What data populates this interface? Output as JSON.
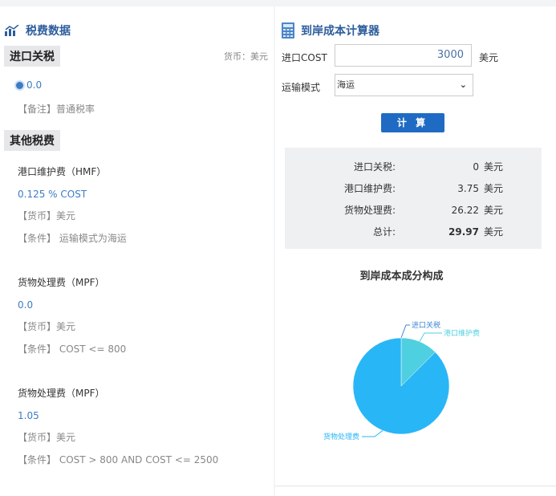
{
  "left": {
    "title": "税费数据",
    "title_icon": "bar-chart-icon",
    "import_tax": {
      "heading": "进口关税",
      "currency_note": "货币：美元",
      "rate": "0.0",
      "note": "【备注】普通税率"
    },
    "other": {
      "heading": "其他税费",
      "items": [
        {
          "name": "港口维护费（HMF）",
          "value": "0.125 % COST",
          "currency": "【货币】美元",
          "condition": "【条件】 运输模式为海运"
        },
        {
          "name": "货物处理费（MPF）",
          "value": "0.0",
          "currency": "【货币】美元",
          "condition": "【条件】 COST <= 800"
        },
        {
          "name": "货物处理费（MPF）",
          "value": "1.05",
          "currency": "【货币】美元",
          "condition": "【条件】 COST > 800 AND COST <= 2500"
        }
      ]
    }
  },
  "right": {
    "title": "到岸成本计算器",
    "title_icon": "calculator-icon",
    "cost_label": "进口COST",
    "cost_value": "3000",
    "cost_unit": "美元",
    "mode_label": "运输模式",
    "mode_value": "海运",
    "calc_button": "计 算",
    "results": [
      {
        "label": "进口关税:",
        "value": "0",
        "unit": "美元"
      },
      {
        "label": "港口维护费:",
        "value": "3.75",
        "unit": "美元"
      },
      {
        "label": "货物处理费:",
        "value": "26.22",
        "unit": "美元"
      },
      {
        "label": "总计:",
        "value": "29.97",
        "unit": "美元"
      }
    ]
  },
  "chart_data": {
    "type": "pie",
    "title": "到岸成本成分构成",
    "categories": [
      "进口关税",
      "港口维护费",
      "货物处理费"
    ],
    "values": [
      0,
      3.75,
      26.22
    ],
    "colors": [
      "#3a86d6",
      "#4fd0e0",
      "#29b6f6"
    ]
  }
}
